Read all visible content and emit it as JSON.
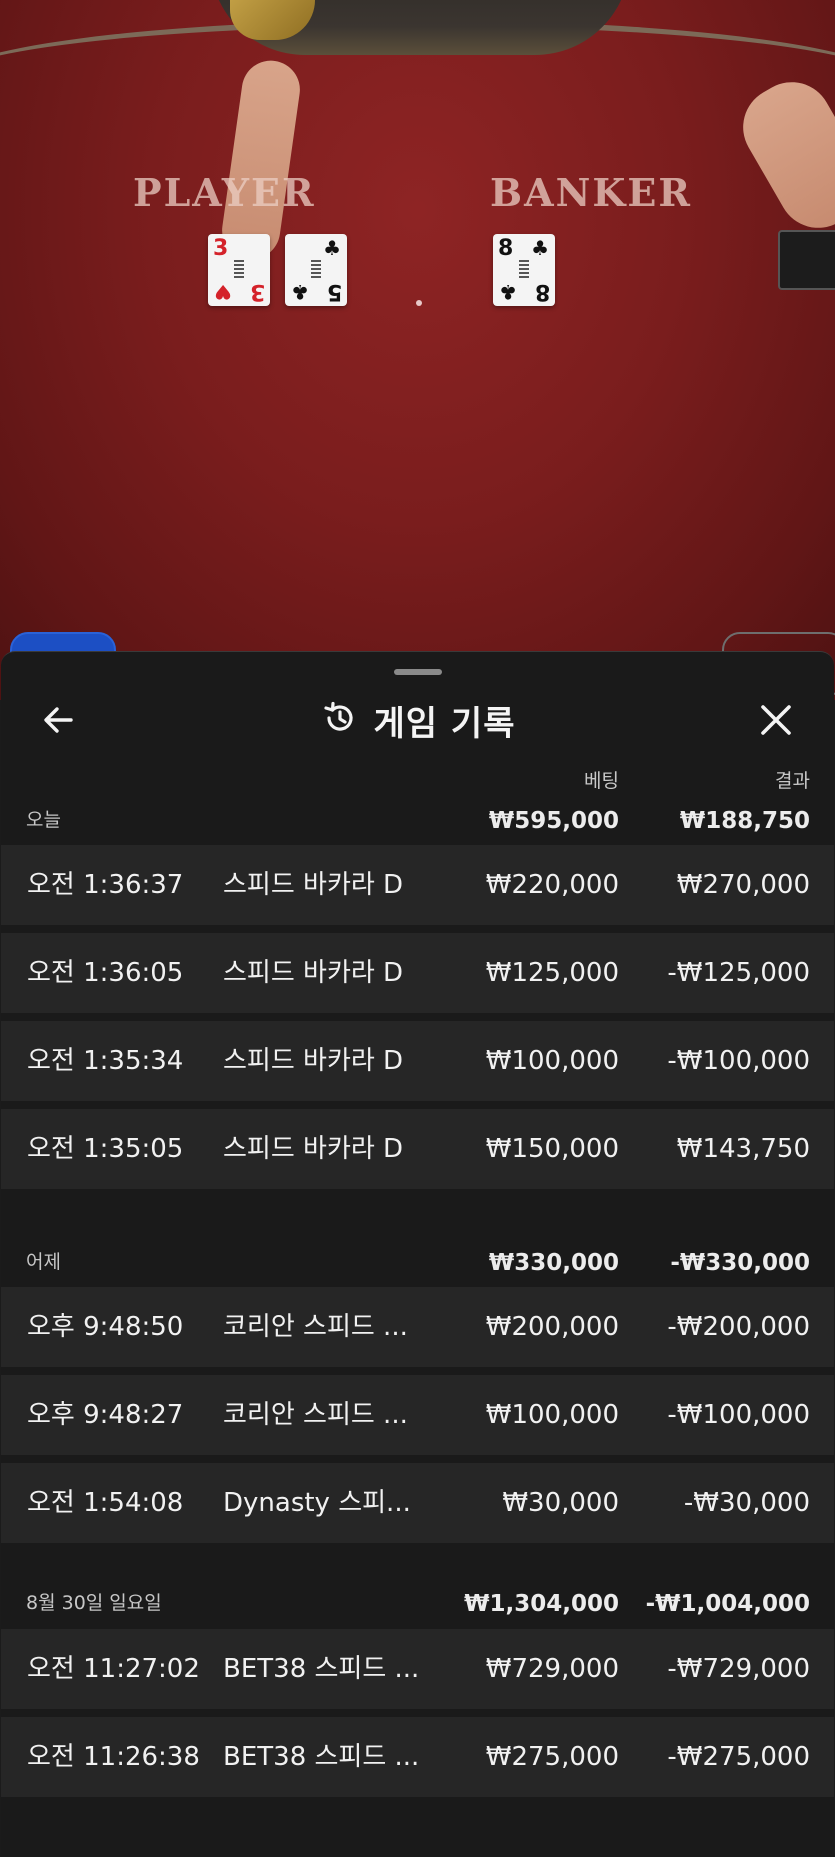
{
  "video": {
    "player_label": "PLAYER",
    "banker_label": "BANKER",
    "player_cards": [
      {
        "rank": "3",
        "suit": "♥",
        "color": "red"
      },
      {
        "rank": "5",
        "suit": "♣",
        "color": "black"
      }
    ],
    "banker_cards": [
      {
        "rank": "8",
        "suit": "♣",
        "color": "black"
      }
    ]
  },
  "sheet": {
    "title": "게임 기록",
    "history_icon": "history-icon",
    "back_icon": "arrow-left-icon",
    "close_icon": "close-icon",
    "columns": {
      "bet": "베팅",
      "result": "결과"
    },
    "groups": [
      {
        "label": "오늘",
        "bet_total": "₩595,000",
        "result_total": "₩188,750",
        "rows": [
          {
            "time": "오전 1:36:37",
            "game": "스피드 바카라 D",
            "bet": "₩220,000",
            "result": "₩270,000"
          },
          {
            "time": "오전 1:36:05",
            "game": "스피드 바카라 D",
            "bet": "₩125,000",
            "result": "-₩125,000"
          },
          {
            "time": "오전 1:35:34",
            "game": "스피드 바카라 D",
            "bet": "₩100,000",
            "result": "-₩100,000"
          },
          {
            "time": "오전 1:35:05",
            "game": "스피드 바카라 D",
            "bet": "₩150,000",
            "result": "₩143,750"
          }
        ]
      },
      {
        "label": "어제",
        "bet_total": "₩330,000",
        "result_total": "-₩330,000",
        "rows": [
          {
            "time": "오후 9:48:50",
            "game": "코리안 스피드 ...",
            "bet": "₩200,000",
            "result": "-₩200,000"
          },
          {
            "time": "오후 9:48:27",
            "game": "코리안 스피드 ...",
            "bet": "₩100,000",
            "result": "-₩100,000"
          },
          {
            "time": "오전 1:54:08",
            "game": "Dynasty 스피...",
            "bet": "₩30,000",
            "result": "-₩30,000"
          }
        ]
      },
      {
        "label": "8월 30일 일요일",
        "bet_total": "₩1,304,000",
        "result_total": "-₩1,004,000",
        "rows": [
          {
            "time": "오전 11:27:02",
            "game": "BET38 스피드 ...",
            "bet": "₩729,000",
            "result": "-₩729,000"
          },
          {
            "time": "오전 11:26:38",
            "game": "BET38 스피드 ...",
            "bet": "₩275,000",
            "result": "-₩275,000"
          }
        ]
      }
    ]
  },
  "colors": {
    "sheet_bg": "#1a1a1a",
    "row_bg": "#262626",
    "table_felt": "#7a1d1d"
  }
}
